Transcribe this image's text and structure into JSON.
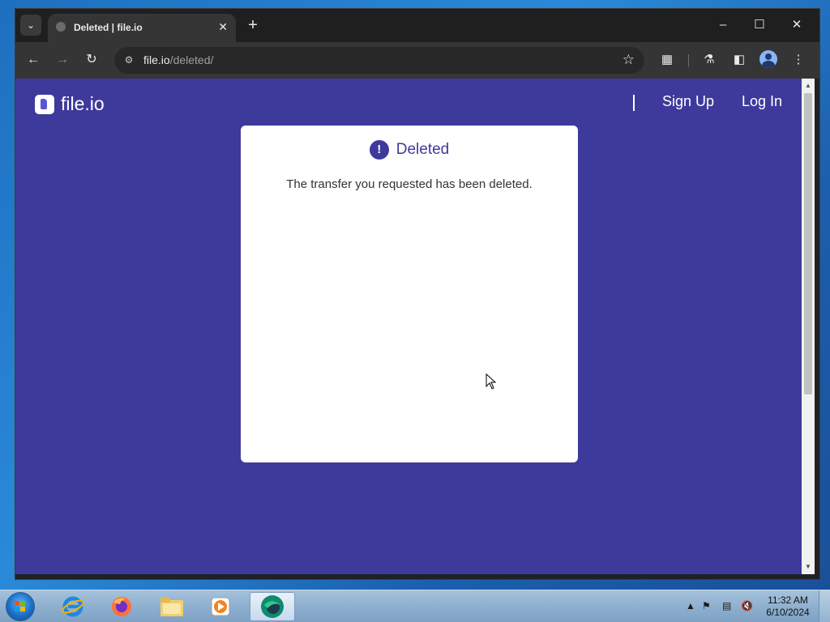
{
  "browser": {
    "tab": {
      "title": "Deleted | file.io"
    },
    "address": {
      "host": "file.io",
      "path": "/deleted/"
    }
  },
  "page": {
    "logo_text": "file.io",
    "nav": {
      "sign_up": "Sign Up",
      "log_in": "Log In"
    },
    "card": {
      "title": "Deleted",
      "alert_glyph": "!",
      "message": "The transfer you requested has been deleted."
    }
  },
  "taskbar": {
    "clock": {
      "time": "11:32 AM",
      "date": "6/10/2024"
    }
  },
  "colors": {
    "page_background": "#3e3a9c",
    "card_background": "#ffffff",
    "accent": "#3e3a9c"
  }
}
